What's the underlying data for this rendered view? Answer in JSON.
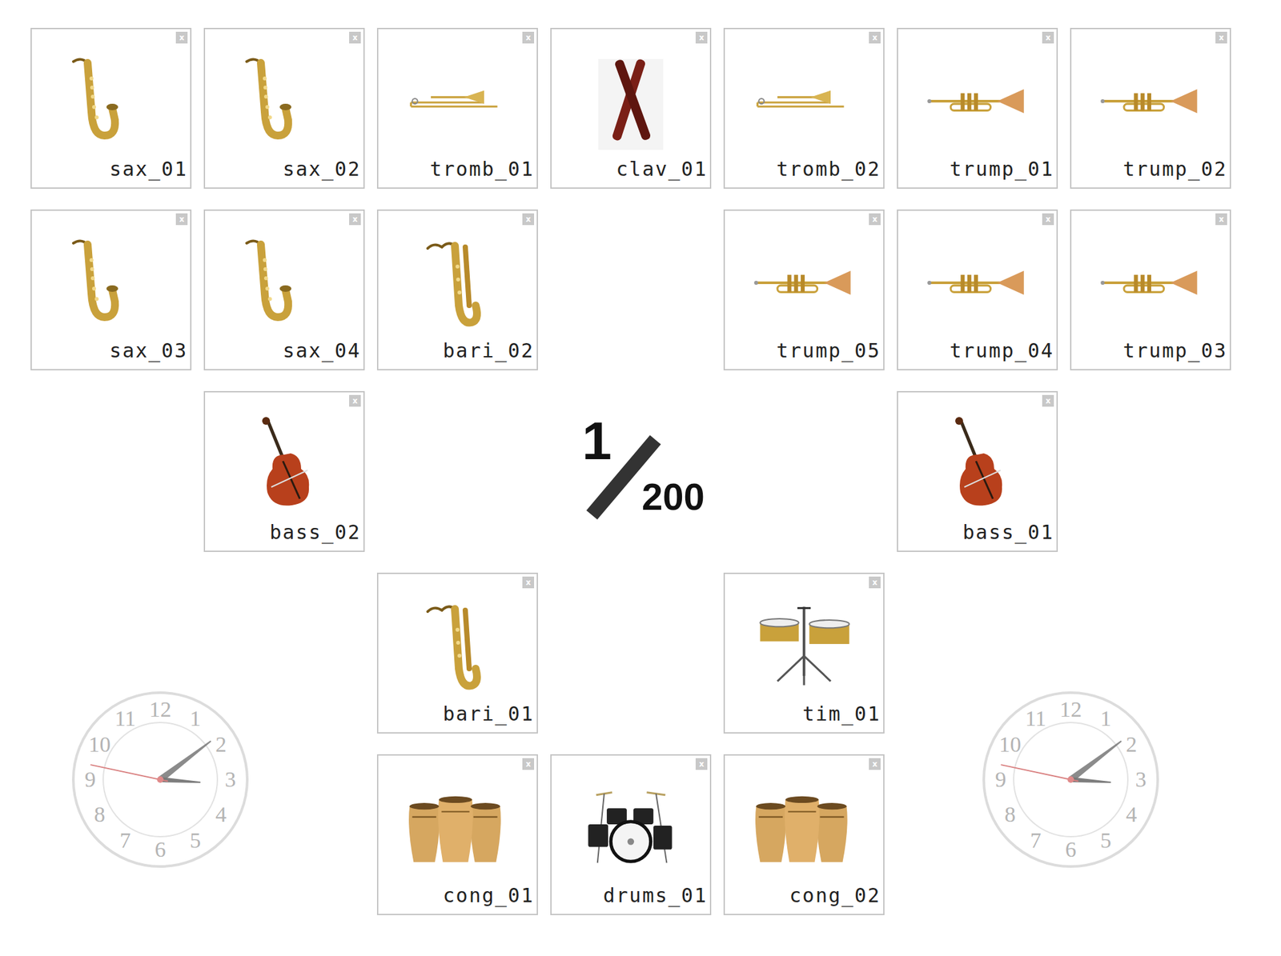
{
  "scale": {
    "numerator": "1",
    "denominator": "200"
  },
  "close_glyph": "x",
  "cards": [
    {
      "label": "sax_01",
      "kind": "sax"
    },
    {
      "label": "sax_02",
      "kind": "sax"
    },
    {
      "label": "tromb_01",
      "kind": "trombone"
    },
    {
      "label": "clav_01",
      "kind": "claves"
    },
    {
      "label": "tromb_02",
      "kind": "trombone"
    },
    {
      "label": "trump_01",
      "kind": "trumpet"
    },
    {
      "label": "trump_02",
      "kind": "trumpet"
    },
    {
      "label": "sax_03",
      "kind": "sax"
    },
    {
      "label": "sax_04",
      "kind": "sax"
    },
    {
      "label": "bari_02",
      "kind": "bari"
    },
    {
      "label": "trump_05",
      "kind": "trumpet"
    },
    {
      "label": "trump_04",
      "kind": "trumpet"
    },
    {
      "label": "trump_03",
      "kind": "trumpet"
    },
    {
      "label": "bass_02",
      "kind": "bass"
    },
    {
      "label": "bass_01",
      "kind": "bass"
    },
    {
      "label": "bari_01",
      "kind": "bari"
    },
    {
      "label": "tim_01",
      "kind": "timbales"
    },
    {
      "label": "cong_01",
      "kind": "congas"
    },
    {
      "label": "drums_01",
      "kind": "drums"
    },
    {
      "label": "cong_02",
      "kind": "congas"
    }
  ],
  "clock_dial": [
    "12",
    "1",
    "2",
    "3",
    "4",
    "5",
    "6",
    "7",
    "8",
    "9",
    "10",
    "11"
  ],
  "clocks": [
    {
      "hours": 3,
      "minutes": 8,
      "seconds": 47
    },
    {
      "hours": 3,
      "minutes": 8,
      "seconds": 47
    }
  ]
}
